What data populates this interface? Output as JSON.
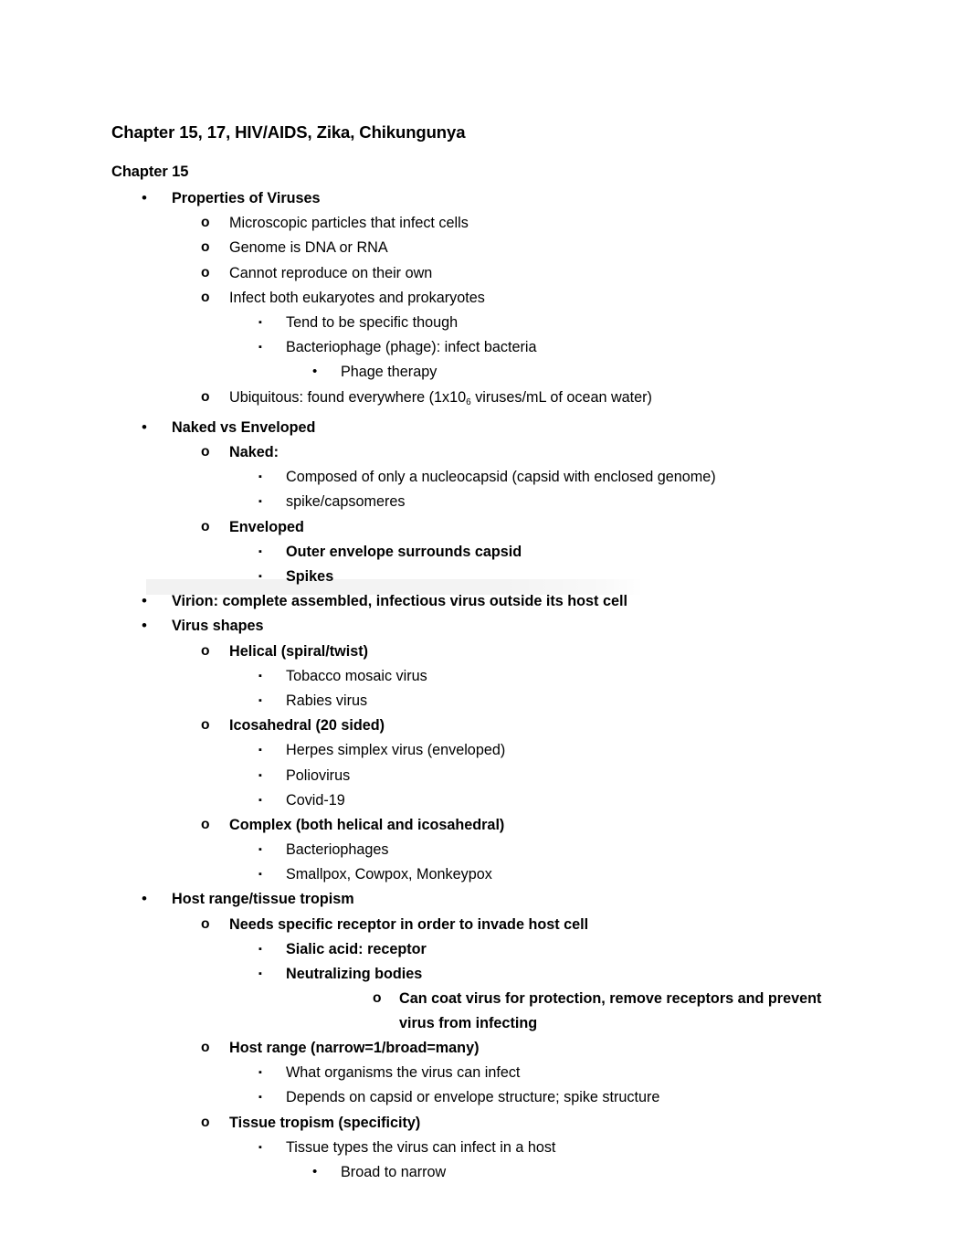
{
  "document": {
    "title": "Chapter 15, 17, HIV/AIDS, Zika, Chikungunya",
    "subtitle": "Chapter 15"
  },
  "markers": {
    "disc": "•",
    "circle": "o",
    "square": "▪"
  },
  "outline": [
    {
      "level": 1,
      "marker": "disc",
      "bold": true,
      "text": "Properties of Viruses"
    },
    {
      "level": 2,
      "marker": "circle",
      "bold": false,
      "text": "Microscopic particles that infect cells"
    },
    {
      "level": 2,
      "marker": "circle",
      "bold": false,
      "text": "Genome is DNA or RNA"
    },
    {
      "level": 2,
      "marker": "circle",
      "bold": false,
      "text": "Cannot reproduce on their own"
    },
    {
      "level": 2,
      "marker": "circle",
      "bold": false,
      "text": "Infect both eukaryotes and prokaryotes"
    },
    {
      "level": 3,
      "marker": "square",
      "bold": false,
      "text": "Tend to be specific though"
    },
    {
      "level": 3,
      "marker": "square",
      "bold": false,
      "text": "Bacteriophage (phage): infect bacteria"
    },
    {
      "level": 4,
      "marker": "disc",
      "bold": false,
      "text": "Phage therapy"
    },
    {
      "level": 2,
      "marker": "circle",
      "bold": false,
      "text": "Ubiquitous: found everywhere (1x10₆ viruses/mL of ocean water)",
      "text_pre": "Ubiquitous: found everywhere (1x10",
      "text_sub": "6",
      "text_post": " viruses/mL of ocean water)"
    },
    {
      "level": 1,
      "marker": "disc",
      "bold": true,
      "text": "Naked vs Enveloped"
    },
    {
      "level": 2,
      "marker": "circle",
      "bold": true,
      "text": "Naked:"
    },
    {
      "level": 3,
      "marker": "square",
      "bold": false,
      "text": "Composed of only a nucleocapsid (capsid with enclosed genome)"
    },
    {
      "level": 3,
      "marker": "square",
      "bold": false,
      "text": "spike/capsomeres"
    },
    {
      "level": 2,
      "marker": "circle",
      "bold": true,
      "text": "Enveloped"
    },
    {
      "level": 3,
      "marker": "square",
      "bold": true,
      "text": "Outer envelope surrounds capsid"
    },
    {
      "level": 3,
      "marker": "square",
      "bold": true,
      "text": "Spikes"
    },
    {
      "level": 1,
      "marker": "disc",
      "bold": true,
      "text": "Virion: complete assembled, infectious virus outside its host cell",
      "highlighted": true
    },
    {
      "level": 1,
      "marker": "disc",
      "bold": true,
      "text": "Virus shapes"
    },
    {
      "level": 2,
      "marker": "circle",
      "bold": true,
      "text": "Helical (spiral/twist)"
    },
    {
      "level": 3,
      "marker": "square",
      "bold": false,
      "text": "Tobacco mosaic virus"
    },
    {
      "level": 3,
      "marker": "square",
      "bold": false,
      "text": "Rabies virus"
    },
    {
      "level": 2,
      "marker": "circle",
      "bold": true,
      "text": "Icosahedral (20 sided)"
    },
    {
      "level": 3,
      "marker": "square",
      "bold": false,
      "text": "Herpes simplex virus (enveloped)"
    },
    {
      "level": 3,
      "marker": "square",
      "bold": false,
      "text": "Poliovirus"
    },
    {
      "level": 3,
      "marker": "square",
      "bold": false,
      "text": "Covid-19"
    },
    {
      "level": 2,
      "marker": "circle",
      "bold": true,
      "text": "Complex (both helical and icosahedral)"
    },
    {
      "level": 3,
      "marker": "square",
      "bold": false,
      "text": "Bacteriophages"
    },
    {
      "level": 3,
      "marker": "square",
      "bold": false,
      "text": "Smallpox, Cowpox, Monkeypox"
    },
    {
      "level": 1,
      "marker": "disc",
      "bold": true,
      "text": "Host range/tissue tropism"
    },
    {
      "level": 2,
      "marker": "circle",
      "bold": true,
      "text": "Needs specific receptor in order to invade host cell"
    },
    {
      "level": 3,
      "marker": "square",
      "bold": true,
      "text": "Sialic acid: receptor"
    },
    {
      "level": 3,
      "marker": "square",
      "bold": true,
      "text": "Neutralizing bodies"
    },
    {
      "level": 5,
      "marker": "circle",
      "bold": true,
      "text": "Can coat virus for protection, remove receptors and prevent virus from infecting"
    },
    {
      "level": 2,
      "marker": "circle",
      "bold": true,
      "text": "Host range (narrow=1/broad=many)"
    },
    {
      "level": 3,
      "marker": "square",
      "bold": false,
      "text": "What organisms the virus can infect"
    },
    {
      "level": 3,
      "marker": "square",
      "bold": false,
      "text": "Depends on capsid or envelope structure; spike structure"
    },
    {
      "level": 2,
      "marker": "circle",
      "bold": true,
      "text": "Tissue tropism (specificity)"
    },
    {
      "level": 3,
      "marker": "square",
      "bold": false,
      "text": "Tissue types the virus can infect in a host"
    },
    {
      "level": 4,
      "marker": "disc",
      "bold": false,
      "text": "Broad to narrow"
    }
  ]
}
